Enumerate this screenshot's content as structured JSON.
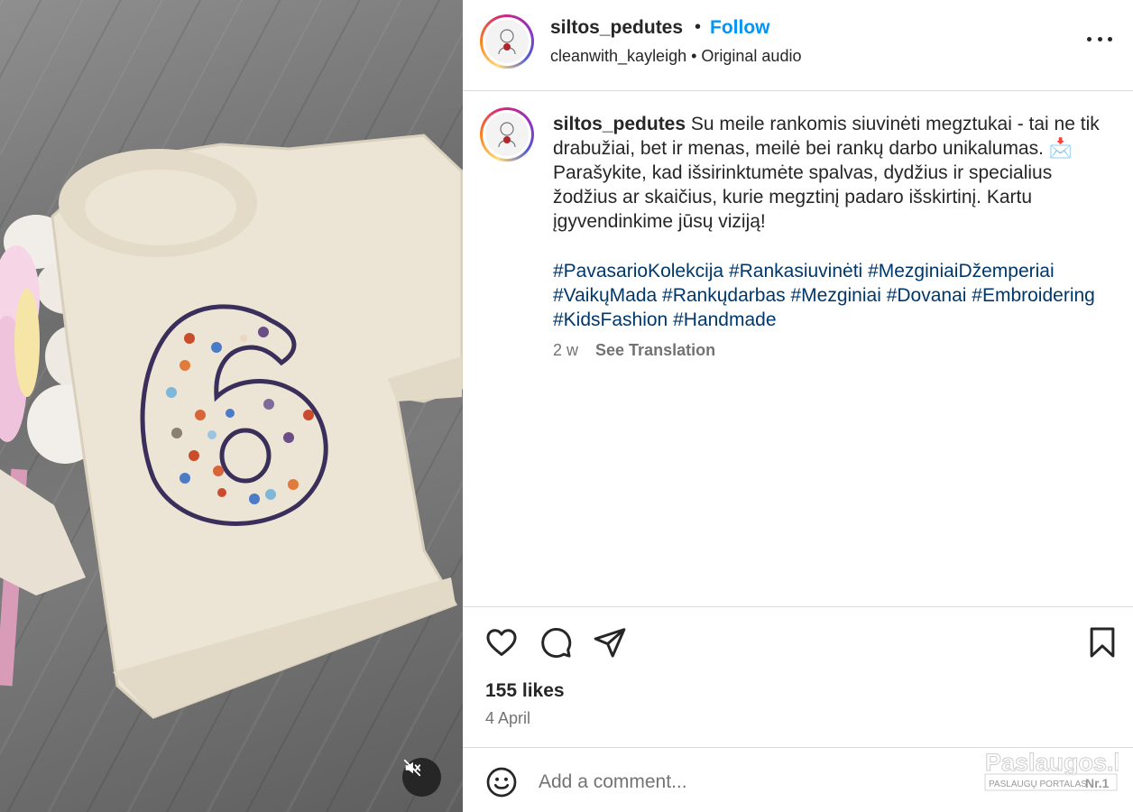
{
  "header": {
    "username": "siltos_pedutes",
    "separator": "•",
    "follow_label": "Follow",
    "audio_text": "cleanwith_kayleigh  •  Original audio"
  },
  "caption": {
    "username": "siltos_pedutes",
    "text": "Su meile rankomis siuvinėti megztukai - tai ne tik drabužiai, bet ir menas, meilė bei rankų darbo unikalumas. 📩 Parašykite, kad išsirinktumėte spalvas, dydžius ir specialius žodžius ar skaičius, kurie megztinį padaro išskirtinį. Kartu įgyvendinkime jūsų viziją!",
    "hashtags": [
      "#PavasarioKolekcija",
      "#Rankasiuvinėti",
      "#MezginiaiDžemperiai",
      "#VaikųMada",
      "#Rankųdarbas",
      "#Mezginiai",
      "#Dovanai",
      "#Embroidering",
      "#KidsFashion",
      "#Handmade"
    ],
    "age": "2 w",
    "see_translation": "See Translation"
  },
  "post": {
    "likes": "155 likes",
    "date": "4 April"
  },
  "comment": {
    "placeholder": "Add a comment..."
  },
  "media": {
    "sweater_number": "6"
  },
  "icons": {
    "more": "more-options-icon",
    "mute": "muted-speaker-icon",
    "like": "heart-icon",
    "comment": "speech-bubble-icon",
    "share": "paper-plane-icon",
    "save": "bookmark-icon",
    "emoji": "smiley-icon"
  },
  "watermark": {
    "brand": "Paslaugos.lt",
    "tagline": "PASLAUGŲ PORTALAS",
    "badge": "Nr.1"
  },
  "colors": {
    "follow_blue": "#0095f6",
    "hashtag_blue": "#00376b",
    "text": "#262626",
    "muted": "#737373",
    "divider": "#dbdbdb"
  }
}
